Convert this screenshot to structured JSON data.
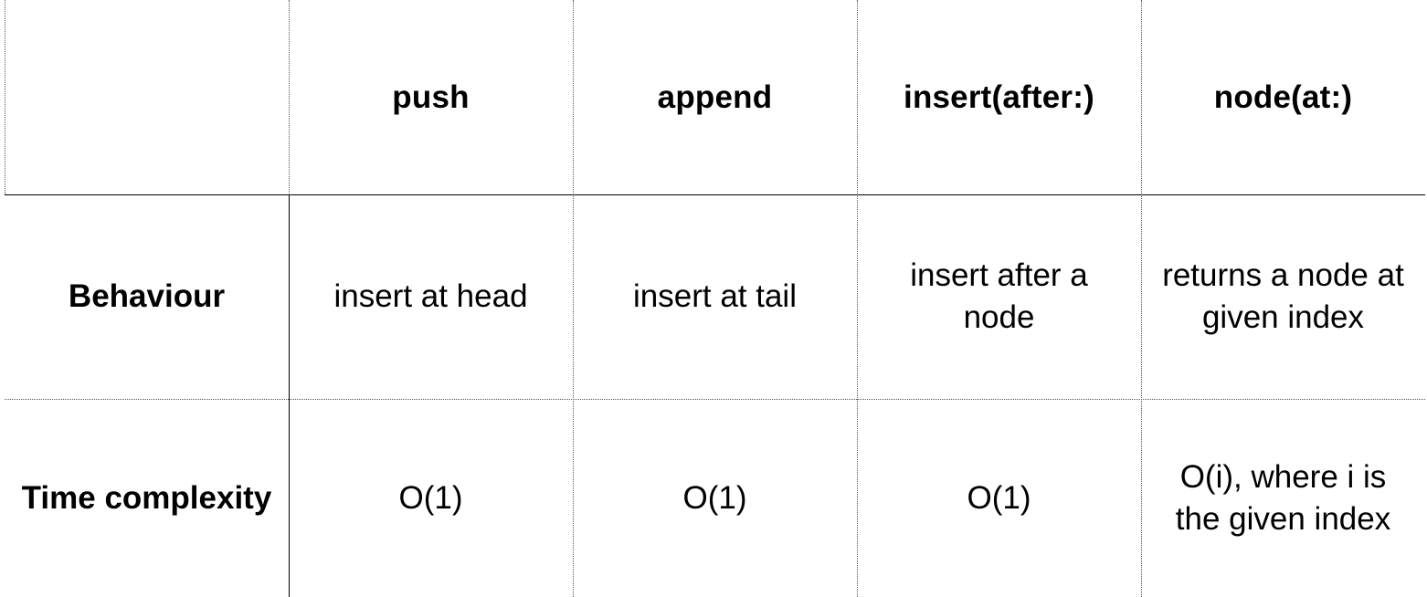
{
  "table": {
    "corner": "",
    "columns": [
      "push",
      "append",
      "insert(after:)",
      "node(at:)"
    ],
    "rows": [
      {
        "label": "Behaviour",
        "cells": [
          "insert at head",
          "insert at tail",
          "insert after a node",
          "returns a node at given index"
        ]
      },
      {
        "label": "Time complexity",
        "cells": [
          "O(1)",
          "O(1)",
          "O(1)",
          "O(i), where i is the given index"
        ]
      }
    ]
  }
}
